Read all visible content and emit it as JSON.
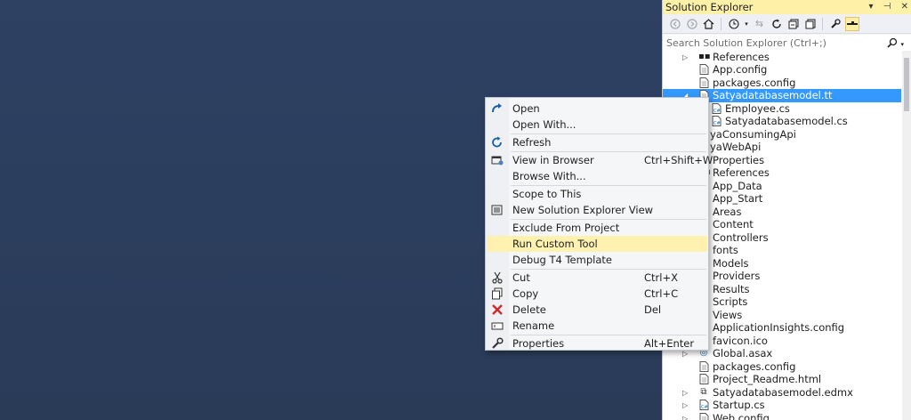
{
  "solution_explorer": {
    "title": "Solution Explorer",
    "title_buttons": [
      "▾",
      "⊣",
      "✕"
    ],
    "search_placeholder": "Search Solution Explorer (Ctrl+;)",
    "tree": [
      {
        "label": "References",
        "icon": "references-icon",
        "arrow": "collapsed"
      },
      {
        "label": "App.config",
        "icon": "config-file-icon"
      },
      {
        "label": "packages.config",
        "icon": "config-file-icon"
      },
      {
        "label": "Satyadatabasemodel.tt",
        "icon": "template-file-icon",
        "arrow": "expanded",
        "selected": true
      },
      {
        "label": "Employee.cs",
        "icon": "cs-file-icon",
        "indent": 1
      },
      {
        "label": "Satyadatabasemodel.cs",
        "icon": "cs-file-icon",
        "indent": 1
      },
      {
        "label": "yaConsumingApi",
        "icon": "project-icon",
        "partial": true
      },
      {
        "label": "yaWebApi",
        "icon": "project-icon",
        "partial": true
      },
      {
        "label": "Properties",
        "icon": "properties-icon"
      },
      {
        "label": "References",
        "icon": "references-icon"
      },
      {
        "label": "App_Data",
        "icon": "folder-icon"
      },
      {
        "label": "App_Start",
        "icon": "folder-icon"
      },
      {
        "label": "Areas",
        "icon": "folder-icon"
      },
      {
        "label": "Content",
        "icon": "folder-icon"
      },
      {
        "label": "Controllers",
        "icon": "folder-icon"
      },
      {
        "label": "fonts",
        "icon": "folder-icon"
      },
      {
        "label": "Models",
        "icon": "folder-icon"
      },
      {
        "label": "Providers",
        "icon": "folder-icon"
      },
      {
        "label": "Results",
        "icon": "folder-icon"
      },
      {
        "label": "Scripts",
        "icon": "folder-icon"
      },
      {
        "label": "Views",
        "icon": "folder-icon"
      },
      {
        "label": "ApplicationInsights.config",
        "icon": "config-file-icon"
      },
      {
        "label": "favicon.ico",
        "icon": "image-file-icon"
      },
      {
        "label": "Global.asax",
        "icon": "asax-file-icon",
        "arrow": "collapsed"
      },
      {
        "label": "packages.config",
        "icon": "config-file-icon"
      },
      {
        "label": "Project_Readme.html",
        "icon": "html-file-icon"
      },
      {
        "label": "Satyadatabasemodel.edmx",
        "icon": "edmx-file-icon",
        "arrow": "collapsed"
      },
      {
        "label": "Startup.cs",
        "icon": "cs-file-icon",
        "arrow": "collapsed"
      },
      {
        "label": "Web.config",
        "icon": "config-file-icon",
        "arrow": "collapsed"
      }
    ]
  },
  "context_menu": {
    "items": [
      {
        "label": "Open",
        "icon": "open-icon",
        "shortcut": ""
      },
      {
        "label": "Open With...",
        "icon": "",
        "shortcut": ""
      },
      {
        "separator": true
      },
      {
        "label": "Refresh",
        "icon": "refresh-icon",
        "shortcut": ""
      },
      {
        "separator": true
      },
      {
        "label": "View in Browser",
        "icon": "browser-icon",
        "shortcut": "Ctrl+Shift+W"
      },
      {
        "label": "Browse With...",
        "icon": "",
        "shortcut": ""
      },
      {
        "separator": true
      },
      {
        "label": "Scope to This",
        "icon": "",
        "shortcut": ""
      },
      {
        "label": "New Solution Explorer View",
        "icon": "new-view-icon",
        "shortcut": ""
      },
      {
        "separator": true
      },
      {
        "label": "Exclude From Project",
        "icon": "",
        "shortcut": ""
      },
      {
        "label": "Run Custom Tool",
        "icon": "",
        "shortcut": "",
        "highlighted": true
      },
      {
        "label": "Debug T4 Template",
        "icon": "",
        "shortcut": ""
      },
      {
        "separator": true
      },
      {
        "label": "Cut",
        "icon": "cut-icon",
        "shortcut": "Ctrl+X"
      },
      {
        "label": "Copy",
        "icon": "copy-icon",
        "shortcut": "Ctrl+C"
      },
      {
        "label": "Delete",
        "icon": "delete-icon",
        "shortcut": "Del"
      },
      {
        "label": "Rename",
        "icon": "rename-icon",
        "shortcut": ""
      },
      {
        "separator": true
      },
      {
        "label": "Properties",
        "icon": "wrench-icon",
        "shortcut": "Alt+Enter"
      }
    ]
  },
  "colors": {
    "editor_background": "#2c3f5e",
    "selection": "#3399ff",
    "menu_highlight": "#fff2b0",
    "title_bar": "#fff1a8"
  }
}
